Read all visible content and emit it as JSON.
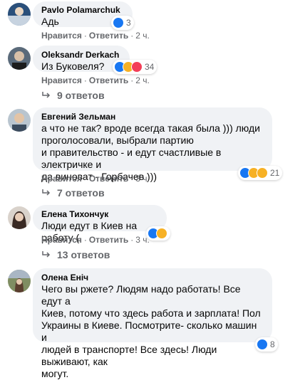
{
  "actions": {
    "like": "Нравится",
    "reply": "Ответить",
    "dot": "·"
  },
  "colors": {
    "bubble": "#f0f2f5",
    "muted": "#65676b",
    "like": "#1877f2"
  },
  "comments": [
    {
      "author": "Pavlo Polamarchuk",
      "text": "Адь",
      "time": "2 ч.",
      "reactions": {
        "icons": [
          "like-icon"
        ],
        "count": "3"
      }
    },
    {
      "author": "Oleksandr Derkach",
      "text": "Из Буковеля?",
      "time": "2 ч.",
      "reactions": {
        "icons": [
          "like-icon",
          "laugh-icon",
          "love-icon"
        ],
        "count": "34"
      },
      "replies": "9 ответов"
    },
    {
      "author": "Евгений Зельман",
      "text": "а что не так? вроде всегда такая была ))) люди\nпроголосовали, выбрали партию\nи правительство - и едут счастливые в электричке и\nда виноват - Горбачев )))",
      "time": "3 ч.",
      "reactions": {
        "icons": [
          "like-icon",
          "laugh-icon",
          "sad-icon"
        ],
        "count": "21"
      },
      "replies": "7 ответов"
    },
    {
      "author": "Елена Тихончук",
      "text": "Люди едут в Киев на работу (",
      "time": "3 ч.",
      "reactions": {
        "icons": [
          "like-icon",
          "sad-icon"
        ],
        "count": ""
      },
      "replies": "13 ответов"
    },
    {
      "author": "Олена Еніч",
      "text": "Чего вы ржете? Людям надо работать! Все едут а\nКиев, потому что здесь работа и зарплата! Пол\nУкраины в Киеве. Посмотрите- сколько машин и\nлюдей в транспорте! Все здесь! Люди выживают, как\nмогут.",
      "time": "",
      "reactions": {
        "icons": [
          "like-icon"
        ],
        "count": "8"
      }
    }
  ]
}
